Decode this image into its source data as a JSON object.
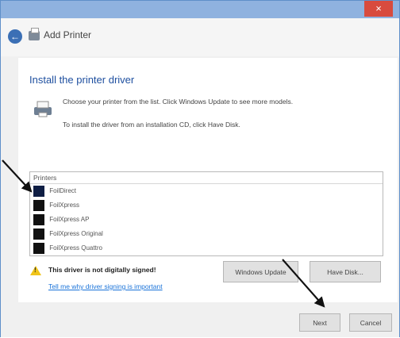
{
  "window": {
    "close_label": "×",
    "header_title": "Add Printer"
  },
  "content": {
    "title": "Install the printer driver",
    "instruction_1": "Choose your printer from the list. Click Windows Update to see more models.",
    "instruction_2": "To install the driver from an installation CD, click Have Disk."
  },
  "printer_list": {
    "header": "Printers",
    "items": [
      {
        "label": "FoilDirect",
        "selected": true
      },
      {
        "label": "FoilXpress",
        "selected": false
      },
      {
        "label": "FoilXpress AP",
        "selected": false
      },
      {
        "label": "FoilXpress Original",
        "selected": false
      },
      {
        "label": "FoilXpress Quattro",
        "selected": false
      }
    ]
  },
  "buttons": {
    "windows_update": "Windows Update",
    "have_disk": "Have Disk...",
    "next": "Next",
    "cancel": "Cancel"
  },
  "warning": {
    "text": "This driver is not digitally signed!",
    "link": "Tell me why driver signing is important"
  }
}
